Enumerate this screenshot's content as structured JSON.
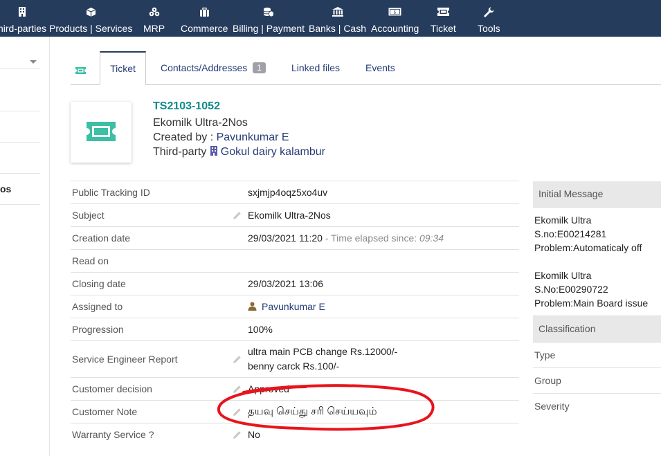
{
  "menu": [
    {
      "label": "hird-parties",
      "icon": "building-icon"
    },
    {
      "label": "Products | Services",
      "icon": "cube-icon"
    },
    {
      "label": "MRP",
      "icon": "cubes-icon"
    },
    {
      "label": "Commerce",
      "icon": "briefcase-icon"
    },
    {
      "label": "Billing | Payment",
      "icon": "coins-icon"
    },
    {
      "label": "Banks | Cash",
      "icon": "bank-icon"
    },
    {
      "label": "Accounting",
      "icon": "money-bill-icon"
    },
    {
      "label": "Ticket",
      "icon": "ticket-icon"
    },
    {
      "label": "Tools",
      "icon": "wrench-icon"
    }
  ],
  "left_panel": {
    "text": "os"
  },
  "tabs": [
    {
      "label": "Ticket"
    },
    {
      "label": "Contacts/Addresses",
      "badge": "1"
    },
    {
      "label": "Linked files"
    },
    {
      "label": "Events"
    }
  ],
  "header": {
    "ref": "TS2103-1052",
    "subject": "Ekomilk Ultra-2Nos",
    "created_by_label": "Created by : ",
    "created_by": "Pavunkumar E",
    "thirdparty_label": "Third-party ",
    "thirdparty": "Gokul dairy kalambur"
  },
  "fields": {
    "tracking": {
      "label": "Public Tracking ID",
      "value": "sxjmjp4oqz5xo4uv"
    },
    "subject": {
      "label": "Subject",
      "value": "Ekomilk Ultra-2Nos"
    },
    "creation": {
      "label": "Creation date",
      "value": "29/03/2021 11:20",
      "elapsed_label": " - Time elapsed since: ",
      "elapsed": "09:34"
    },
    "read_on": {
      "label": "Read on",
      "value": ""
    },
    "closing": {
      "label": "Closing date",
      "value": "29/03/2021 13:06"
    },
    "assigned": {
      "label": "Assigned to",
      "value": "Pavunkumar E"
    },
    "progression": {
      "label": "Progression",
      "value": "100%"
    },
    "report": {
      "label": "Service Engineer Report",
      "line1": "ultra main PCB change Rs.12000/-",
      "line2": "benny carck Rs.100/-"
    },
    "decision": {
      "label": "Customer decision",
      "value": "Approved"
    },
    "note": {
      "label": "Customer Note",
      "value": "தயவு செய்து சரி செய்யவும்"
    },
    "warranty": {
      "label": "Warranty Service ?",
      "value": "No"
    }
  },
  "right_panel": {
    "initial_title": "Initial Message",
    "msg1": [
      "Ekomilk Ultra",
      "S.no:E00214281",
      "Problem:Automaticaly off"
    ],
    "msg2": [
      "Ekomilk Ultra",
      "S.No:E00290722",
      "Problem:Main Board issue"
    ],
    "classification_title": "Classification",
    "type_label": "Type",
    "group_label": "Group",
    "severity_label": "Severity"
  },
  "colors": {
    "topbar": "#263c5c",
    "accent_teal": "#0f8a8a",
    "report_green": "#2bb34a",
    "annotation_red": "#e8141c"
  }
}
